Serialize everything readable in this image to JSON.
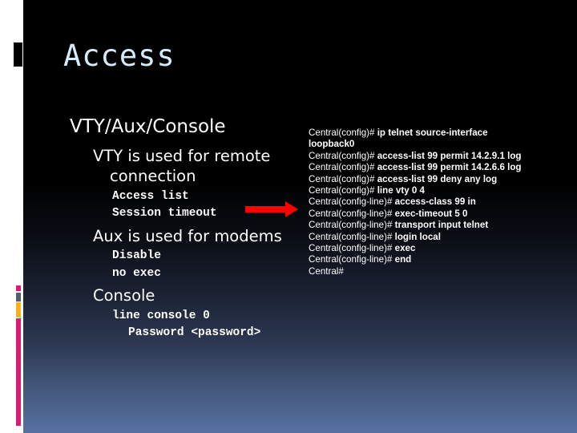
{
  "slide": {
    "title": "Access",
    "heading": "VTY/Aux/Console",
    "sections": [
      {
        "label_line1": "VTY is used for remote",
        "label_line2": "connection",
        "items": [
          "Access list",
          "Session timeout"
        ]
      },
      {
        "label": "Aux is used for modems",
        "items": [
          "Disable",
          "no exec"
        ]
      },
      {
        "label": "Console",
        "items": [
          "line console 0",
          "Password <password>"
        ]
      }
    ],
    "arrow_color": "#ff0000",
    "accent_colors": [
      "#d81b74",
      "#545e6a",
      "#f5b21a",
      "#d81b74"
    ]
  },
  "cli": [
    {
      "prompt": "Central(config)# ",
      "cmd": "ip telnet source-interface"
    },
    {
      "prompt": "",
      "cmd": "loopback0"
    },
    {
      "prompt": "Central(config)# ",
      "cmd": "access-list 99 permit 14.2.9.1 log"
    },
    {
      "prompt": "Central(config)# ",
      "cmd": "access-list 99 permit 14.2.6.6 log"
    },
    {
      "prompt": "Central(config)# ",
      "cmd": "access-list 99 deny any log"
    },
    {
      "prompt": "Central(config)# ",
      "cmd": "line vty 0 4"
    },
    {
      "prompt": "Central(config-line)# ",
      "cmd": "access-class 99 in"
    },
    {
      "prompt": "Central(config-line)# ",
      "cmd": "exec-timeout 5 0"
    },
    {
      "prompt": "Central(config-line)# ",
      "cmd": "transport input telnet"
    },
    {
      "prompt": "Central(config-line)# ",
      "cmd": "login local"
    },
    {
      "prompt": "Central(config-line)# ",
      "cmd": "exec"
    },
    {
      "prompt": "Central(config-line)# ",
      "cmd": "end"
    },
    {
      "prompt": "Central#",
      "cmd": ""
    }
  ]
}
